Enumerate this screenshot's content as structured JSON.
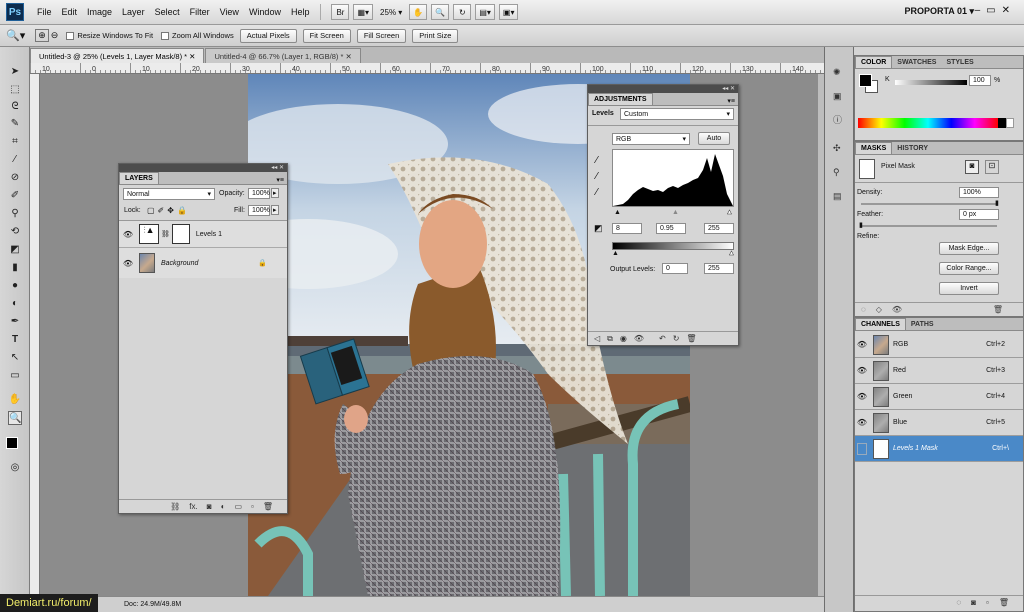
{
  "app": {
    "logo": "Ps",
    "workspace": "PROPORTA 01 ▾",
    "zoom": "25%"
  },
  "menu": [
    "File",
    "Edit",
    "Image",
    "Layer",
    "Select",
    "Filter",
    "View",
    "Window",
    "Help"
  ],
  "menubar_buttons": {
    "bridge": "Br",
    "window_ctrls": [
      "–",
      "▭",
      "✕"
    ]
  },
  "options_bar": {
    "resize_label": "Resize Windows To Fit",
    "zoom_all_label": "Zoom All Windows",
    "buttons": [
      "Actual Pixels",
      "Fit Screen",
      "Fill Screen",
      "Print Size"
    ]
  },
  "tabs": [
    {
      "label": "Untitled-3 @ 25% (Levels 1, Layer Mask/8) *  ✕",
      "active": true
    },
    {
      "label": "Untitled-4 @ 66.7% (Layer 1, RGB/8) *  ✕",
      "active": false
    }
  ],
  "ruler_labels": [
    "10",
    "0",
    "10",
    "20",
    "30",
    "40",
    "50",
    "60",
    "70",
    "80",
    "90",
    "100",
    "110",
    "120",
    "130",
    "140"
  ],
  "status": {
    "doc_size": "Doc: 24.9M/49.8M"
  },
  "watermark": "Demiart.ru/forum/",
  "layers_panel": {
    "tab": "LAYERS",
    "blend_mode": "Normal",
    "opacity_label": "Opacity:",
    "opacity": "100%",
    "lock_label": "Lock:",
    "fill_label": "Fill:",
    "fill": "100%",
    "layers": [
      {
        "name": "Levels 1",
        "italic": false
      },
      {
        "name": "Background",
        "italic": true
      }
    ]
  },
  "adjustments_panel": {
    "tab": "ADJUSTMENTS",
    "title": "Levels",
    "preset": "Custom",
    "channel": "RGB",
    "auto_label": "Auto",
    "input_black": "8",
    "input_gamma": "0.95",
    "input_white": "255",
    "output_label": "Output Levels:",
    "output_black": "0",
    "output_white": "255"
  },
  "color_panel": {
    "tabs": [
      "COLOR",
      "SWATCHES",
      "STYLES"
    ],
    "channel_label": "K",
    "value": "100",
    "unit": "%"
  },
  "masks_panel": {
    "tabs": [
      "MASKS",
      "HISTORY"
    ],
    "mask_type": "Pixel Mask",
    "density_label": "Density:",
    "density": "100%",
    "feather_label": "Feather:",
    "feather": "0 px",
    "refine_label": "Refine:",
    "buttons": [
      "Mask Edge...",
      "Color Range...",
      "Invert"
    ]
  },
  "channels_panel": {
    "tabs": [
      "CHANNELS",
      "PATHS"
    ],
    "channels": [
      {
        "name": "RGB",
        "shortcut": "Ctrl+2"
      },
      {
        "name": "Red",
        "shortcut": "Ctrl+3"
      },
      {
        "name": "Green",
        "shortcut": "Ctrl+4"
      },
      {
        "name": "Blue",
        "shortcut": "Ctrl+5"
      },
      {
        "name": "Levels 1 Mask",
        "shortcut": "Ctrl+\\"
      }
    ]
  },
  "colors": {
    "accent_selection": "#4a89c8",
    "panel_bg": "#d6d6d6",
    "panel_header": "#4c4c4c"
  }
}
